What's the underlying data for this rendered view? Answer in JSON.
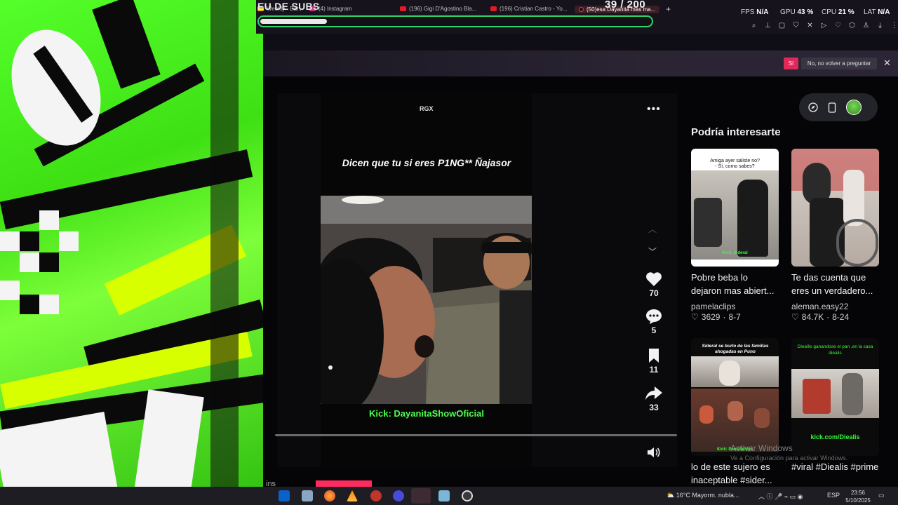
{
  "stream_title": "EU DE SUBS",
  "counter": "39 / 200",
  "progress": 0.17,
  "browser": {
    "tabs": [
      {
        "label": "Weekly - Bar...",
        "icon": "music-icon"
      },
      {
        "label": "(4) Instagram",
        "icon": "instagram-icon"
      },
      {
        "label": "(196) Gigi D'Agostino Bla...",
        "icon": "youtube-icon"
      },
      {
        "label": "(196) Cristian Castro - Yo...",
        "icon": "youtube-icon"
      },
      {
        "label": "(50)esa Dayanita mas ma...",
        "icon": "tiktok-icon",
        "active": true
      }
    ],
    "new_tab": "+"
  },
  "perf": {
    "fps_label": "FPS",
    "fps": "N/A",
    "gpu_label": "GPU",
    "gpu": "43 %",
    "cpu_label": "CPU",
    "cpu": "21 %",
    "lat_label": "LAT",
    "lat": "N/A"
  },
  "notification": {
    "yes": "Sí",
    "no": "No, no volver a preguntar"
  },
  "video": {
    "watermark_tag": "RGX",
    "caption": "Dicen que tu si eres P1NG** Ñajasor",
    "kick_label": "Kick: DayanitaShowOficial",
    "likes": "70",
    "comments": "5",
    "saves": "11",
    "shares": "33",
    "seek_progress": 0.02
  },
  "sidebar": {
    "title": "Podría interesarte",
    "cards": [
      {
        "overlay": "Amiga ayer saliste no?\n- Sí, como sabes?",
        "overlay2": "Kick: Sideral",
        "title": "Pobre beba lo dejaron mas abiert...",
        "author": "pamelaclips",
        "likes": "3629",
        "date": "8-7"
      },
      {
        "overlay": "",
        "overlay2": "",
        "title": "Te das cuenta que eres un verdadero...",
        "author": "aleman.easy22",
        "likes": "84.7K",
        "date": "8-24"
      },
      {
        "overlay": "Sideral se burlo de las familias ahogadas en Puno",
        "overlay2": "Kick: Pamelaclips",
        "title": "lo de este sujero es inaceptable #sider...",
        "author": "",
        "likes": "",
        "date": ""
      },
      {
        "overlay": "Dieallis ganandose el pan ,en la casa diealis",
        "overlay2": "kick.com/Diealis",
        "title": "#viral #Diealis #prime",
        "author": "",
        "likes": "",
        "date": ""
      }
    ]
  },
  "windows_watermark": {
    "line1": "Activar Windows",
    "line2": "Ve a Configuración para activar Windows."
  },
  "bottom_label": "ins",
  "taskbar": {
    "weather": "16°C  Mayorm. nubla...",
    "lang": "ESP",
    "time": "23:56",
    "date": "5/10/2025"
  }
}
